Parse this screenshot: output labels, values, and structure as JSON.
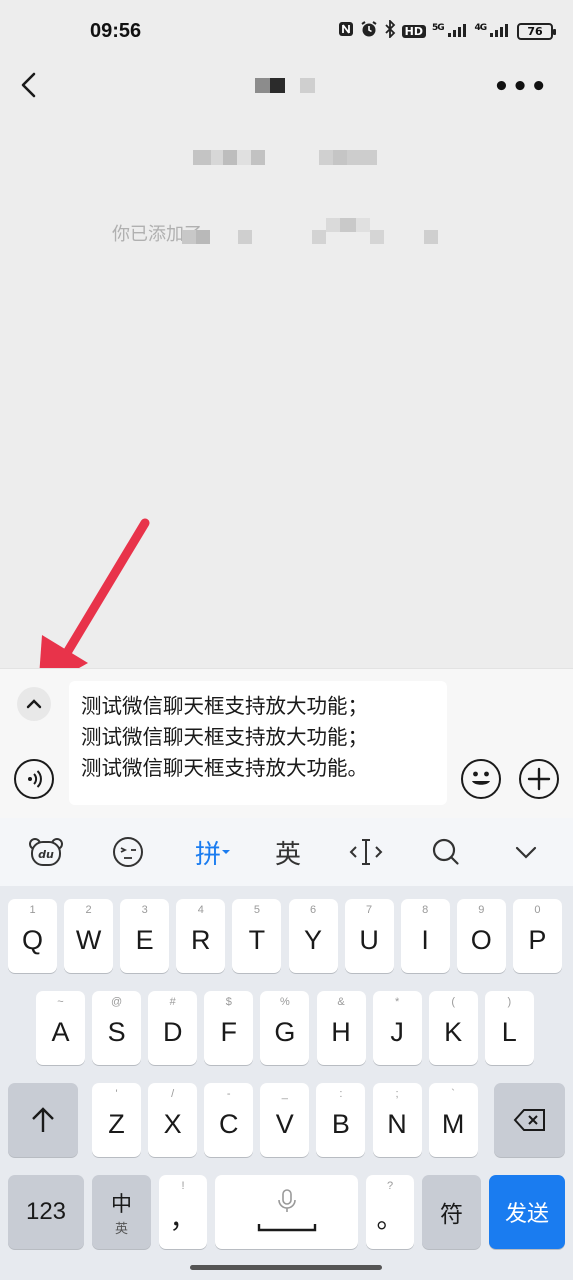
{
  "status": {
    "time": "09:56",
    "battery": "76",
    "signal_1": "5G",
    "signal_2": "4G",
    "hd_label": "HD"
  },
  "nav": {
    "more_label": "•••"
  },
  "system_message": {
    "prefix": "你已添加了"
  },
  "composer": {
    "lines": [
      "测试微信聊天框支持放大功能；",
      "测试微信聊天框支持放大功能；",
      "测试微信聊天框支持放大功能。"
    ],
    "expand_label": "⌃",
    "plus_label": "+"
  },
  "toolbar": {
    "pinyin_label": "拼",
    "english_label": "英",
    "cursor_label": "‹I›",
    "collapse_label": "⌄"
  },
  "keyboard": {
    "row1": [
      {
        "key": "Q",
        "hint": "1"
      },
      {
        "key": "W",
        "hint": "2"
      },
      {
        "key": "E",
        "hint": "3"
      },
      {
        "key": "R",
        "hint": "4"
      },
      {
        "key": "T",
        "hint": "5"
      },
      {
        "key": "Y",
        "hint": "6"
      },
      {
        "key": "U",
        "hint": "7"
      },
      {
        "key": "I",
        "hint": "8"
      },
      {
        "key": "O",
        "hint": "9"
      },
      {
        "key": "P",
        "hint": "0"
      }
    ],
    "row2": [
      {
        "key": "A",
        "hint": "~"
      },
      {
        "key": "S",
        "hint": "@"
      },
      {
        "key": "D",
        "hint": "#"
      },
      {
        "key": "F",
        "hint": "$"
      },
      {
        "key": "G",
        "hint": "%"
      },
      {
        "key": "H",
        "hint": "&"
      },
      {
        "key": "J",
        "hint": "*"
      },
      {
        "key": "K",
        "hint": "("
      },
      {
        "key": "L",
        "hint": ")"
      }
    ],
    "row3": [
      {
        "key": "Z",
        "hint": "'"
      },
      {
        "key": "X",
        "hint": "/"
      },
      {
        "key": "C",
        "hint": "-"
      },
      {
        "key": "V",
        "hint": "_"
      },
      {
        "key": "B",
        "hint": ":"
      },
      {
        "key": "N",
        "hint": ";"
      },
      {
        "key": "M",
        "hint": "`"
      }
    ],
    "shift_label": "↑",
    "delete_label": "⌫",
    "num_label": "123",
    "zh_label": "中",
    "zh_sub": "英",
    "comma_label": "，",
    "comma_hint": "!",
    "period_label": "。",
    "period_hint": "?",
    "symbol_label": "符",
    "send_label": "发送"
  },
  "colors": {
    "accent": "#1a7cf0",
    "arrow": "#e8334a"
  }
}
